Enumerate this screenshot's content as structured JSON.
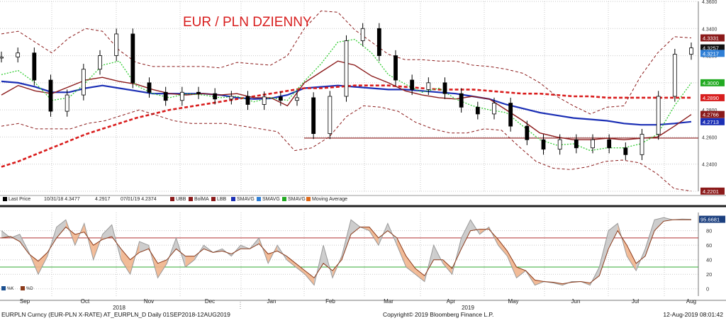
{
  "chart_data": [
    {
      "type": "line",
      "title": "EUR / PLN DZIENNY",
      "title_color": "#d81e1e",
      "ylim": [
        4.22,
        4.36
      ],
      "y_ticks": [
        4.22,
        4.24,
        4.26,
        4.28,
        4.3,
        4.32,
        4.34,
        4.36
      ],
      "y_tick_labels": [
        "4.2200",
        "4.2400",
        "4.2600",
        "4.2800",
        "4.3000",
        "4.3200",
        "4.3400",
        "4.3600"
      ],
      "x_months": [
        "Sep",
        "Oct",
        "Nov",
        "Dec",
        "Jan",
        "Feb",
        "Mar",
        "Apr",
        "May",
        "Jun",
        "Jul",
        "Aug"
      ],
      "x_years": [
        "2018",
        "2019"
      ],
      "grid": true,
      "horizontal_line": {
        "value": 4.2592,
        "from": "Jan end",
        "color": "#8b1a1a"
      },
      "series": [
        {
          "name": "Last Price",
          "kind": "candlestick",
          "color": "#000000",
          "values": [
            4.319,
            4.322,
            4.302,
            4.279,
            4.291,
            4.31,
            4.32,
            4.336,
            4.3,
            4.293,
            4.287,
            4.293,
            4.292,
            4.288,
            4.29,
            4.284,
            4.2896,
            4.287,
            4.289,
            4.2625,
            4.29,
            4.331,
            4.34,
            4.32,
            4.302,
            4.295,
            4.3,
            4.292,
            4.282,
            4.277,
            4.285,
            4.268,
            4.258,
            4.251,
            4.258,
            4.252,
            4.258,
            4.252,
            4.247,
            4.262,
            4.29,
            4.321,
            4.3257
          ]
        },
        {
          "name": "SMAVG",
          "color": "#1b2fb5",
          "values": [
            4.301,
            4.3,
            4.297,
            4.293,
            4.293,
            4.296,
            4.298,
            4.296,
            4.294,
            4.292,
            4.292,
            4.292,
            4.292,
            4.291,
            4.289,
            4.288,
            4.2885,
            4.291,
            4.296,
            4.297,
            4.298,
            4.297,
            4.296,
            4.295,
            4.295,
            4.294,
            4.293,
            4.292,
            4.29,
            4.288,
            4.284,
            4.281,
            4.278,
            4.276,
            4.274,
            4.273,
            4.272,
            4.27,
            4.269,
            4.269,
            4.27,
            4.2713
          ]
        },
        {
          "name": "SMAVG",
          "color": "#d91c1c",
          "dashed": true,
          "values": [
            4.238,
            4.242,
            4.247,
            4.252,
            4.257,
            4.262,
            4.266,
            4.27,
            4.274,
            4.277,
            4.28,
            4.282,
            4.284,
            4.286,
            4.288,
            4.29,
            4.292,
            4.294,
            4.296,
            4.296,
            4.297,
            4.298,
            4.298,
            4.298,
            4.297,
            4.296,
            4.295,
            4.295,
            4.295,
            4.294,
            4.293,
            4.292,
            4.292,
            4.291,
            4.29,
            4.29,
            4.289,
            4.289,
            4.289,
            4.289,
            4.289,
            4.289
          ]
        },
        {
          "name": "BolMA",
          "color": "#8b1a1a",
          "values": [
            4.291,
            4.298,
            4.294,
            4.292,
            4.297,
            4.302,
            4.304,
            4.301,
            4.299,
            4.295,
            4.292,
            4.291,
            4.292,
            4.291,
            4.292,
            4.289,
            4.289,
            4.283,
            4.3,
            4.308,
            4.316,
            4.313,
            4.305,
            4.3,
            4.294,
            4.291,
            4.289,
            4.288,
            4.29,
            4.288,
            4.28,
            4.272,
            4.263,
            4.26,
            4.258,
            4.258,
            4.259,
            4.258,
            4.259,
            4.26,
            4.268,
            4.2766
          ]
        },
        {
          "name": "UBB",
          "color": "#8b1a1a",
          "dashed": true,
          "values": [
            4.336,
            4.338,
            4.33,
            4.322,
            4.333,
            4.34,
            4.338,
            4.324,
            4.315,
            4.312,
            4.312,
            4.312,
            4.312,
            4.311,
            4.315,
            4.314,
            4.313,
            4.32,
            4.34,
            4.353,
            4.352,
            4.339,
            4.33,
            4.321,
            4.317,
            4.317,
            4.316,
            4.316,
            4.313,
            4.312,
            4.31,
            4.307,
            4.3,
            4.29,
            4.283,
            4.277,
            4.282,
            4.283,
            4.305,
            4.322,
            4.334,
            4.3331
          ]
        },
        {
          "name": "LBB",
          "color": "#8b1a1a",
          "dashed": true,
          "values": [
            4.268,
            4.27,
            4.266,
            4.266,
            4.266,
            4.27,
            4.272,
            4.276,
            4.28,
            4.276,
            4.272,
            4.27,
            4.27,
            4.27,
            4.268,
            4.266,
            4.264,
            4.25,
            4.252,
            4.26,
            4.275,
            4.283,
            4.282,
            4.279,
            4.271,
            4.266,
            4.263,
            4.263,
            4.266,
            4.265,
            4.253,
            4.242,
            4.237,
            4.236,
            4.238,
            4.242,
            4.243,
            4.241,
            4.233,
            4.222,
            4.2201
          ]
        },
        {
          "name": "SMAVG",
          "color": "#33cc33",
          "dotted": true,
          "values": [
            4.306,
            4.309,
            4.3,
            4.287,
            4.289,
            4.3,
            4.313,
            4.316,
            4.298,
            4.292,
            4.289,
            4.292,
            4.291,
            4.289,
            4.29,
            4.286,
            4.289,
            4.287,
            4.301,
            4.314,
            4.33,
            4.332,
            4.322,
            4.306,
            4.299,
            4.293,
            4.296,
            4.288,
            4.283,
            4.28,
            4.278,
            4.268,
            4.258,
            4.254,
            4.255,
            4.25,
            4.252,
            4.252,
            4.255,
            4.262,
            4.283,
            4.3
          ]
        }
      ],
      "right_labels": [
        {
          "text": "4.3331",
          "value": 4.3331,
          "bg": "#8b1a1a",
          "fg": "#ffffff"
        },
        {
          "text": "4.3257",
          "value": 4.3257,
          "bg": "#111111",
          "fg": "#ffffff"
        },
        {
          "text": "4.3217",
          "value": 4.3217,
          "bg": "#2f7fd6",
          "fg": "#ffffff"
        },
        {
          "text": "4.3000",
          "value": 4.3,
          "bg": "#22aa22",
          "fg": "#ffffff"
        },
        {
          "text": "4.2890",
          "value": 4.289,
          "bg": "#d81e1e",
          "fg": "#ffffff"
        },
        {
          "text": "4.2766",
          "value": 4.2766,
          "bg": "#8b1a1a",
          "fg": "#ffffff"
        },
        {
          "text": "4.2713",
          "value": 4.2713,
          "bg": "#1b2fb5",
          "fg": "#ffffff"
        },
        {
          "text": "4.2201",
          "value": 4.2201,
          "bg": "#8b1a1a",
          "fg": "#ffffff"
        }
      ]
    },
    {
      "type": "line",
      "ylim": [
        -10,
        105
      ],
      "y_ticks": [
        0,
        20,
        40,
        60,
        80
      ],
      "y_tick_labels": [
        "0",
        "20",
        "40",
        "60",
        "80"
      ],
      "reference_lines": [
        {
          "value": 70,
          "color": "#b03030"
        },
        {
          "value": 30,
          "color": "#33aa33"
        }
      ],
      "last_value_label": {
        "text": "95.6681",
        "value": 95.6681
      },
      "series": [
        {
          "name": "%K",
          "color": "#9a9a9a",
          "values": [
            80,
            70,
            75,
            50,
            20,
            45,
            85,
            95,
            60,
            90,
            40,
            75,
            88,
            40,
            20,
            65,
            60,
            15,
            35,
            70,
            30,
            40,
            60,
            50,
            55,
            45,
            60,
            55,
            70,
            35,
            60,
            40,
            30,
            20,
            5,
            60,
            15,
            45,
            95,
            85,
            80,
            60,
            90,
            60,
            30,
            20,
            10,
            60,
            35,
            20,
            70,
            95,
            75,
            85,
            60,
            45,
            15,
            25,
            5,
            10,
            8,
            5,
            10,
            10,
            5,
            30,
            80,
            90,
            45,
            25,
            55,
            95,
            98,
            95,
            96,
            95.6681
          ]
        },
        {
          "name": "%D",
          "color": "#8b3a1a",
          "values": [
            70,
            72,
            65,
            48,
            38,
            50,
            70,
            85,
            75,
            78,
            60,
            68,
            72,
            55,
            40,
            50,
            55,
            35,
            40,
            55,
            45,
            45,
            55,
            50,
            52,
            48,
            55,
            55,
            62,
            48,
            52,
            45,
            35,
            25,
            15,
            35,
            25,
            40,
            75,
            85,
            85,
            70,
            80,
            70,
            45,
            28,
            18,
            40,
            40,
            28,
            55,
            80,
            82,
            82,
            68,
            52,
            30,
            25,
            12,
            10,
            9,
            7,
            9,
            10,
            8,
            18,
            55,
            80,
            60,
            35,
            45,
            80,
            93,
            95,
            95,
            95
          ]
        }
      ]
    }
  ],
  "legend": {
    "items": [
      {
        "label": "Last Price",
        "color": "#000000"
      },
      {
        "label": "10/31/18 4.3477",
        "color": ""
      },
      {
        "label": "4.2917",
        "color": ""
      },
      {
        "label": "07/01/19 4.2374",
        "color": ""
      },
      {
        "label": "UBB",
        "color": "#8b1a1a"
      },
      {
        "label": "BolMA",
        "color": "#8b1a1a"
      },
      {
        "label": "LBB",
        "color": "#8b1a1a"
      },
      {
        "label": "SMAVG",
        "color": "#1b2fb5"
      },
      {
        "label": "SMAVG",
        "color": "#2f7fd6"
      },
      {
        "label": "SMAVG",
        "color": "#22aa22"
      },
      {
        "label": "Moving Average",
        "color": "#e06a1a"
      }
    ],
    "lower": [
      {
        "label": "%K",
        "color": "#1b4f8f"
      },
      {
        "label": "%D",
        "color": "#8b3a1a"
      }
    ]
  },
  "footer": {
    "left": "EURPLN Curncy (EUR-PLN X-RATE) AT_EURPLN_D  Daily 01SEP2018-12AUG2019",
    "center": "Copyright© 2019 Bloomberg Finance L.P.",
    "right": "12-Aug-2019 08:01:42"
  }
}
